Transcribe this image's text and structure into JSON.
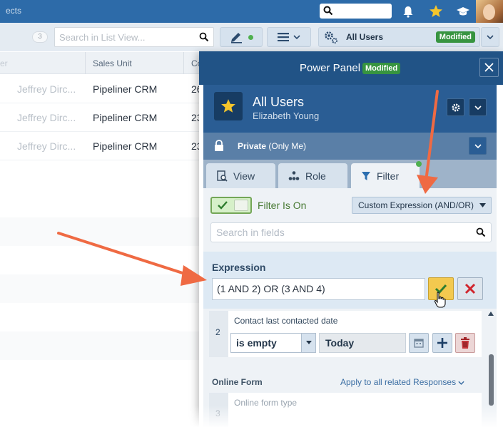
{
  "topbar": {
    "app_label": "ects",
    "search_placeholder": ""
  },
  "toolbar": {
    "count": "3",
    "search_placeholder": "Search in List View...",
    "view_label": "All Users",
    "view_badge": "Modified"
  },
  "grid": {
    "columns": [
      "Owner",
      "Sales Unit",
      "Created"
    ],
    "col_partials": [
      "er",
      "Sales Unit",
      "Co"
    ],
    "rows": [
      {
        "owner": "Jeffrey Dirc...",
        "sales_unit": "Pipeliner CRM",
        "created": "26"
      },
      {
        "owner": "Jeffrey Dirc...",
        "sales_unit": "Pipeliner CRM",
        "created": "23"
      },
      {
        "owner": "Jeffrey Dirc...",
        "sales_unit": "Pipeliner CRM",
        "created": "23"
      }
    ]
  },
  "panel": {
    "title": "Power Panel",
    "badge": "Modified",
    "view_name": "All Users",
    "owner": "Elizabeth Young",
    "privacy_bold": "Private",
    "privacy_rest": " (Only Me)",
    "tabs": [
      {
        "label": "View"
      },
      {
        "label": "Role"
      },
      {
        "label": "Filter"
      }
    ],
    "filter_toggle_label": "Filter Is On",
    "filter_mode": "Custom Expression (AND/OR)",
    "field_search_placeholder": "Search in fields",
    "expression_label": "Expression",
    "expression_value": "(1 AND 2) OR (3 AND 4)",
    "condition2": {
      "number": "2",
      "field": "Contact last contacted date",
      "operator": "is empty",
      "value": "Today"
    },
    "section_title": "Online Form",
    "apply_link": "Apply to all related Responses",
    "condition3": {
      "number": "3",
      "field": "Online form type"
    }
  },
  "colors": {
    "brand_blue": "#215386",
    "modified_green": "#379440",
    "arrow_orange": "#ef6a43",
    "confirm_yellow": "#f3c94f"
  }
}
